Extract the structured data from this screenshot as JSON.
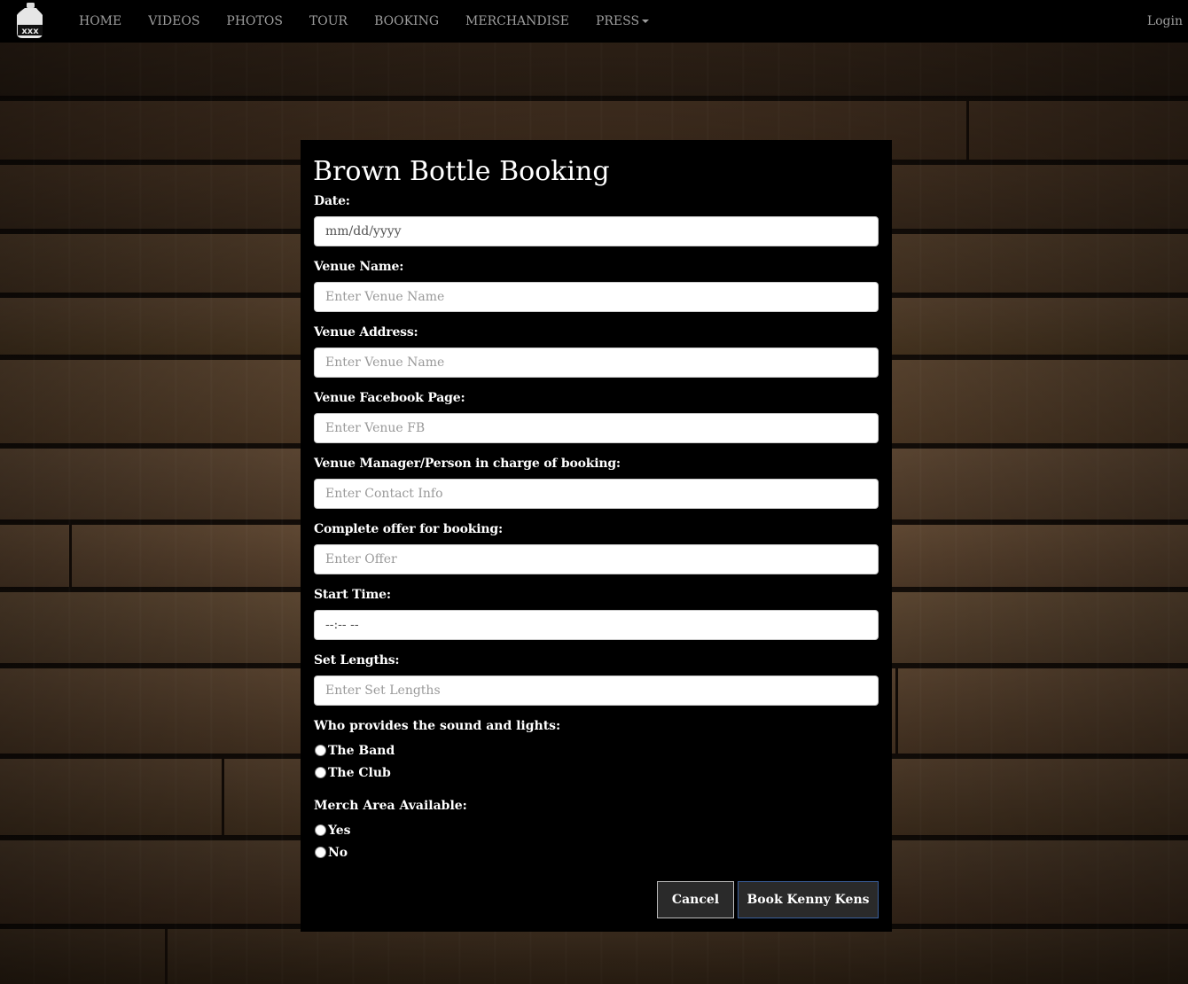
{
  "nav": {
    "items": [
      "HOME",
      "VIDEOS",
      "PHOTOS",
      "TOUR",
      "BOOKING",
      "MERCHANDISE"
    ],
    "press_label": "PRESS",
    "login_label": "Login",
    "logo_text": "xxx"
  },
  "form": {
    "title": "Brown Bottle Booking",
    "fields": [
      {
        "label": "Date:",
        "placeholder": "mm/dd/yyyy",
        "type": "date"
      },
      {
        "label": "Venue Name:",
        "placeholder": "Enter Venue Name",
        "type": "text"
      },
      {
        "label": "Venue Address:",
        "placeholder": "Enter Venue Name",
        "type": "text"
      },
      {
        "label": "Venue Facebook Page:",
        "placeholder": "Enter Venue FB",
        "type": "text"
      },
      {
        "label": "Venue Manager/Person in charge of booking:",
        "placeholder": "Enter Contact Info",
        "type": "text"
      },
      {
        "label": "Complete offer for booking:",
        "placeholder": "Enter Offer",
        "type": "text"
      },
      {
        "label": "Start Time:",
        "placeholder": "--:-- --",
        "type": "time"
      },
      {
        "label": "Set Lengths:",
        "placeholder": "Enter Set Lengths",
        "type": "text"
      }
    ],
    "sound_lights": {
      "label": "Who provides the sound and lights:",
      "options": [
        "The Band",
        "The Club"
      ]
    },
    "merch": {
      "label": "Merch Area Available:",
      "options": [
        "Yes",
        "No"
      ]
    },
    "cancel_label": "Cancel",
    "submit_label": "Book Kenny Kens"
  }
}
